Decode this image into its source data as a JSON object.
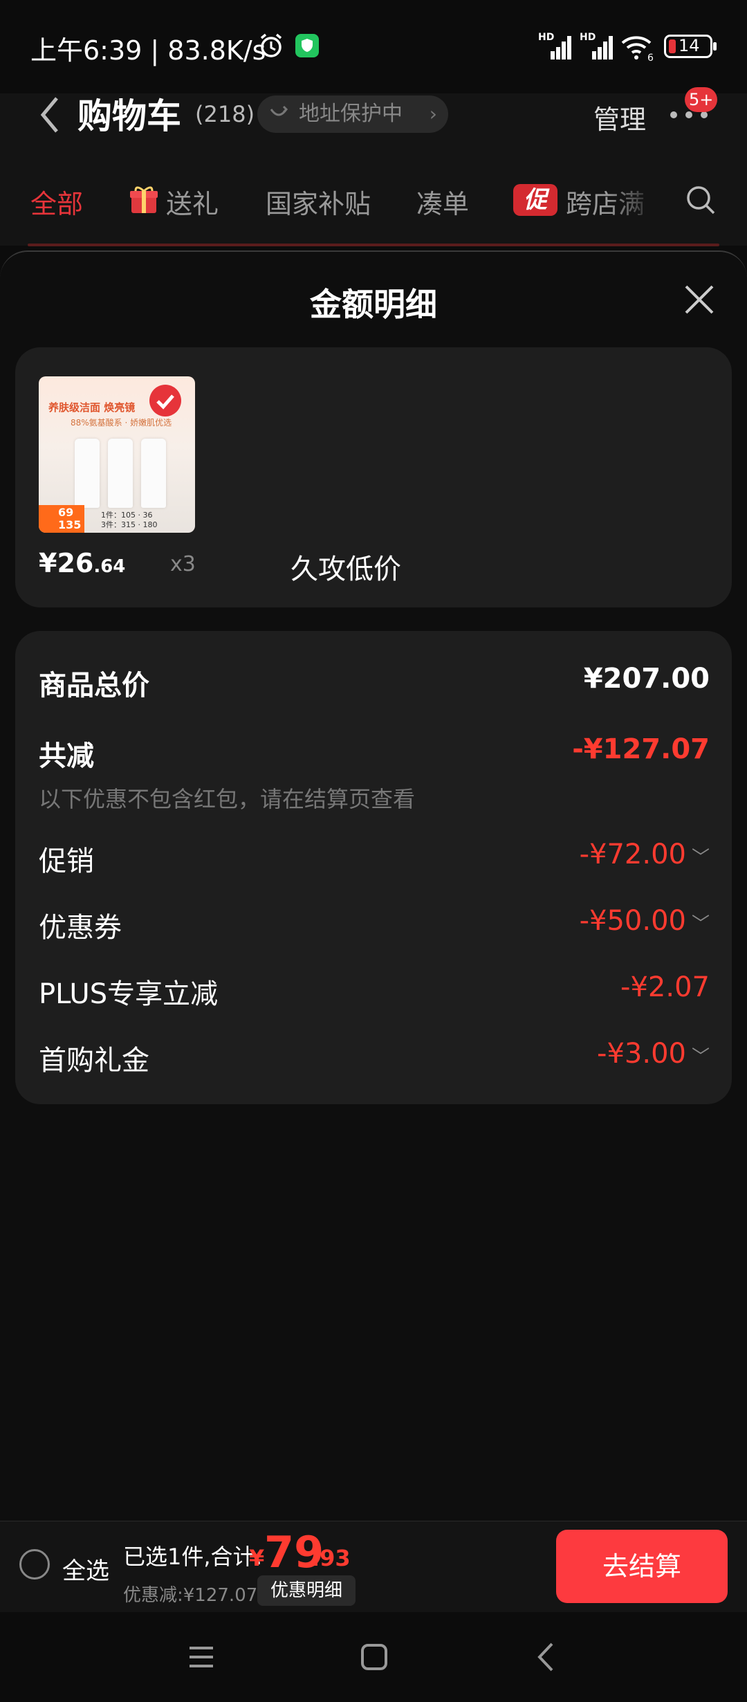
{
  "status_bar": {
    "time": "上午6:39 | 83.8K/s",
    "battery": "14",
    "signal1_label": "HD",
    "signal2_label": "HD",
    "wifi_label": "6"
  },
  "header": {
    "title": "购物车",
    "count": "(218)",
    "address_text": "地址保护中",
    "manage": "管理",
    "badge": "5+"
  },
  "tabs": [
    {
      "label": "全部"
    },
    {
      "label": "送礼"
    },
    {
      "label": "国家补贴"
    },
    {
      "label": "凑单"
    },
    {
      "label": "跨店满"
    }
  ],
  "promo_tag": "促",
  "sheet": {
    "title": "金额明细",
    "product": {
      "price_main": "¥26",
      "price_decimal": ".64",
      "quantity": "x3",
      "image_text": {
        "line1": "养肤级洁面 焕亮镜",
        "line2": "88%氨基酸系 · 娇嫩肌优选",
        "price_a": "69",
        "price_b": "135",
        "row1": "1件：105 · 36",
        "row2": "3件：315 · 180"
      }
    },
    "breakdown": {
      "total_label": "商品总价",
      "total_value": "¥207.00",
      "reduce_label": "共减",
      "reduce_value": "-¥127.07",
      "note": "以下优惠不包含红包，请在结算页查看",
      "overlay_text": "久攻低价",
      "items": [
        {
          "label": "促销",
          "value": "-¥72.00"
        },
        {
          "label": "优惠券",
          "value": "-¥50.00"
        },
        {
          "label": "PLUS专享立减",
          "value": "-¥2.07"
        },
        {
          "label": "首购礼金",
          "value": "-¥3.00"
        }
      ]
    }
  },
  "bottom_bar": {
    "select_all": "全选",
    "summary": "已选1件,合计:",
    "currency": "¥",
    "amount_main": "79",
    "amount_decimal": ".93",
    "discount": "优惠减:¥127.07",
    "detail_button": "优惠明细",
    "checkout": "去结算"
  },
  "colors": {
    "accent": "#ff3b30",
    "checkout_bg": "#fd3a3f",
    "sheet_bg": "#0e0e0e",
    "card_bg": "#1e1e1e"
  }
}
